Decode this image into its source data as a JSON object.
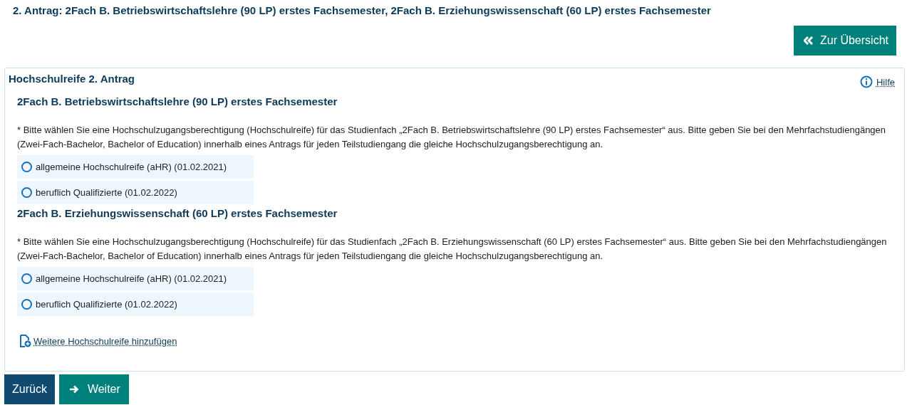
{
  "page_title": "2. Antrag: 2Fach B. Betriebswirtschaftslehre (90 LP) erstes Fachsemester, 2Fach B. Erziehungswissenschaft (60 LP) erstes Fachsemester",
  "overview_button": "Zur Übersicht",
  "panel": {
    "title": "Hochschulreife 2. Antrag",
    "help_link": "Hilfe",
    "sections": [
      {
        "heading": "2Fach B. Betriebswirtschaftslehre (90 LP) erstes Fachsemester",
        "instruction": "* Bitte wählen Sie eine Hochschulzugangsberechtigung (Hochschulreife) für das Studienfach „2Fach B. Betriebswirtschaftslehre (90 LP) erstes Fachsemester“ aus. Bitte geben Sie bei den Mehrfachstudiengängen (Zwei-Fach-Bachelor, Bachelor of Education) innerhalb eines Antrags für jeden Teilstudiengang die gleiche Hochschulzugangsberechtigung an.",
        "options": [
          {
            "label": "allgemeine Hochschulreife (aHR) (01.02.2021)",
            "selected": false
          },
          {
            "label": "beruflich Qualifizierte (01.02.2022)",
            "selected": false
          }
        ]
      },
      {
        "heading": "2Fach B. Erziehungswissenschaft (60 LP) erstes Fachsemester",
        "instruction": "* Bitte wählen Sie eine Hochschulzugangsberechtigung (Hochschulreife) für das Studienfach „2Fach B. Erziehungswissenschaft (60 LP) erstes Fachsemester“ aus. Bitte geben Sie bei den Mehrfachstudiengängen (Zwei-Fach-Bachelor, Bachelor of Education) innerhalb eines Antrags für jeden Teilstudiengang die gleiche Hochschulzugangsberechtigung an.",
        "options": [
          {
            "label": "allgemeine Hochschulreife (aHR) (01.02.2021)",
            "selected": false
          },
          {
            "label": "beruflich Qualifizierte (01.02.2022)",
            "selected": false
          }
        ]
      }
    ],
    "add_link": "Weitere Hochschulreife hinzufügen"
  },
  "back_button": "Zurück",
  "next_button": "Weiter"
}
